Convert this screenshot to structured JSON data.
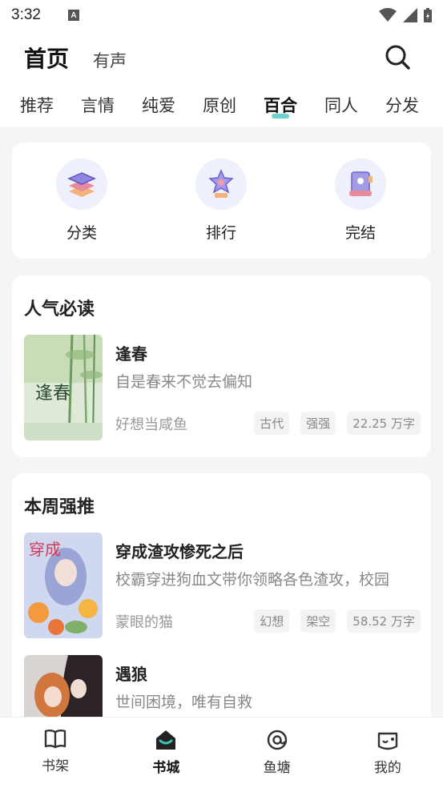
{
  "status_bar": {
    "time": "3:32",
    "notification_letter": "A"
  },
  "header": {
    "title": "首页",
    "audio_tab": "有声",
    "categories": [
      "推荐",
      "言情",
      "纯爱",
      "原创",
      "百合",
      "同人",
      "分发"
    ],
    "active_category": "百合"
  },
  "quick_links": [
    {
      "label": "分类",
      "icon": "layers-icon"
    },
    {
      "label": "排行",
      "icon": "trophy-star-icon"
    },
    {
      "label": "完结",
      "icon": "scroll-icon"
    }
  ],
  "popular": {
    "title": "人气必读",
    "books": [
      {
        "title": "逢春",
        "desc": "自是春来不觉去偏知",
        "author": "好想当咸鱼",
        "tags": [
          "古代",
          "强强",
          "22.25 万字"
        ],
        "cover_text": "逢春"
      }
    ]
  },
  "weekly": {
    "title": "本周强推",
    "books": [
      {
        "title": "穿成渣攻惨死之后",
        "desc": "校霸穿进狗血文带你领略各色渣攻，校园",
        "author": "蒙眼的猫",
        "tags": [
          "幻想",
          "架空",
          "58.52 万字"
        ],
        "cover_text": "穿成"
      },
      {
        "title": "遇狼",
        "desc": "世间困境，唯有自救",
        "author": "",
        "tags": []
      }
    ]
  },
  "tabbar": [
    {
      "label": "书架",
      "icon": "book-open-icon"
    },
    {
      "label": "书城",
      "icon": "bookstore-icon",
      "active": true
    },
    {
      "label": "鱼塘",
      "icon": "at-sign-icon"
    },
    {
      "label": "我的",
      "icon": "profile-icon"
    }
  ],
  "colors": {
    "accent": "#3cc3bd",
    "background": "#f4f5f7",
    "icon_bg": "#eef0fb"
  }
}
